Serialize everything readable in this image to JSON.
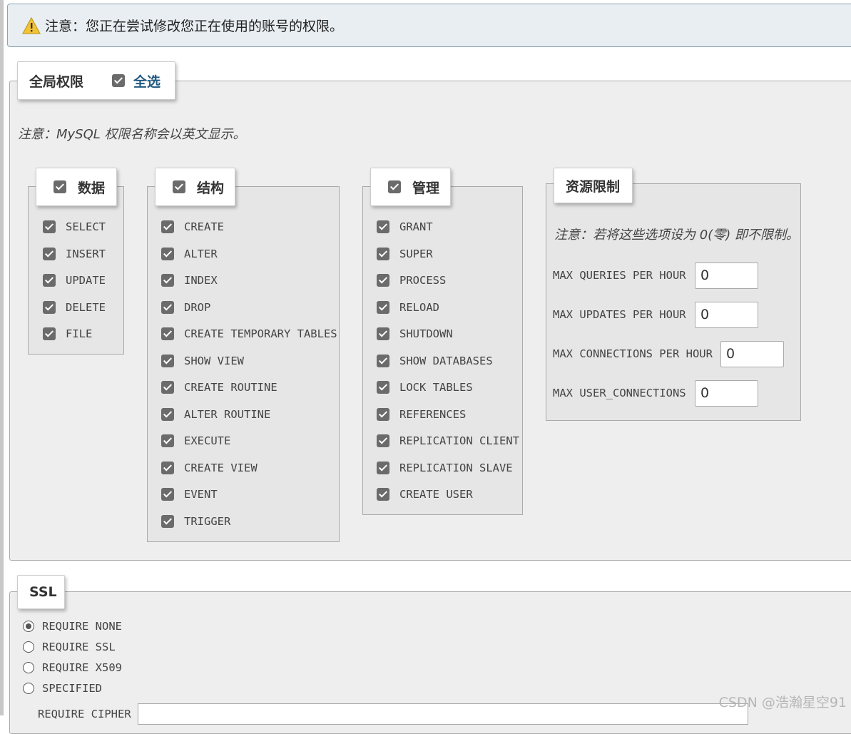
{
  "notice": {
    "text": "注意：您正在尝试修改您正在使用的账号的权限。"
  },
  "global": {
    "legend": "全局权限",
    "select_all_label": "全选",
    "note": "注意：MySQL 权限名称会以英文显示。"
  },
  "groups": {
    "data": {
      "legend": "数据",
      "items": [
        "SELECT",
        "INSERT",
        "UPDATE",
        "DELETE",
        "FILE"
      ]
    },
    "structure": {
      "legend": "结构",
      "items": [
        "CREATE",
        "ALTER",
        "INDEX",
        "DROP",
        "CREATE TEMPORARY TABLES",
        "SHOW VIEW",
        "CREATE ROUTINE",
        "ALTER ROUTINE",
        "EXECUTE",
        "CREATE VIEW",
        "EVENT",
        "TRIGGER"
      ]
    },
    "admin": {
      "legend": "管理",
      "items": [
        "GRANT",
        "SUPER",
        "PROCESS",
        "RELOAD",
        "SHUTDOWN",
        "SHOW DATABASES",
        "LOCK TABLES",
        "REFERENCES",
        "REPLICATION CLIENT",
        "REPLICATION SLAVE",
        "CREATE USER"
      ]
    }
  },
  "resources": {
    "legend": "资源限制",
    "note": "注意：若将这些选项设为 0(零) 即不限制。",
    "limits": [
      {
        "label": "MAX QUERIES PER HOUR",
        "value": "0"
      },
      {
        "label": "MAX UPDATES PER HOUR",
        "value": "0"
      },
      {
        "label": "MAX CONNECTIONS PER HOUR",
        "value": "0"
      },
      {
        "label": "MAX USER_CONNECTIONS",
        "value": "0"
      }
    ]
  },
  "ssl": {
    "legend": "SSL",
    "options": [
      {
        "label": "REQUIRE NONE",
        "checked": true
      },
      {
        "label": "REQUIRE SSL",
        "checked": false
      },
      {
        "label": "REQUIRE X509",
        "checked": false
      },
      {
        "label": "SPECIFIED",
        "checked": false
      }
    ],
    "cipher_label": "REQUIRE CIPHER"
  },
  "watermark": "CSDN @浩瀚星空91"
}
